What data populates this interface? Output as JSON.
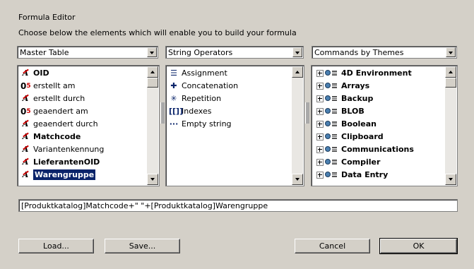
{
  "window": {
    "title": "Formula Editor",
    "subtitle": "Choose below the elements which will enable you to build your formula"
  },
  "dropdowns": {
    "table": "Master Table",
    "operators": "String Operators",
    "commands": "Commands by Themes"
  },
  "fields_list": [
    {
      "label": "OID",
      "icon": "alpha-field-icon",
      "bold": true
    },
    {
      "label": "erstellt am",
      "icon": "numeric-field-icon",
      "bold": false
    },
    {
      "label": "erstellt durch",
      "icon": "alpha-field-icon",
      "bold": false
    },
    {
      "label": "geaendert am",
      "icon": "numeric-field-icon",
      "bold": false
    },
    {
      "label": "geaendert durch",
      "icon": "alpha-field-icon",
      "bold": false
    },
    {
      "label": "Matchcode",
      "icon": "alpha-field-icon",
      "bold": true
    },
    {
      "label": "Variantenkennung",
      "icon": "alpha-field-icon",
      "bold": false
    },
    {
      "label": "LieferantenOID",
      "icon": "alpha-field-icon",
      "bold": true
    },
    {
      "label": "Warengruppe",
      "icon": "alpha-field-icon",
      "bold": true,
      "selected": true
    }
  ],
  "operators_list": [
    {
      "label": "Assignment",
      "icon": "assignment-icon",
      "glyph": "☰"
    },
    {
      "label": "Concatenation",
      "icon": "plus-icon",
      "glyph": "✚"
    },
    {
      "label": "Repetition",
      "icon": "asterisk-icon",
      "glyph": "✳"
    },
    {
      "label": "Indexes",
      "icon": "brackets-icon",
      "glyph": "[[]]"
    },
    {
      "label": "Empty string",
      "icon": "empty-string-icon",
      "glyph": "···"
    }
  ],
  "commands_list": [
    {
      "label": "4D Environment"
    },
    {
      "label": "Arrays"
    },
    {
      "label": "Backup"
    },
    {
      "label": "BLOB"
    },
    {
      "label": "Boolean"
    },
    {
      "label": "Clipboard"
    },
    {
      "label": "Communications"
    },
    {
      "label": "Compiler"
    },
    {
      "label": "Data Entry"
    }
  ],
  "formula": {
    "value": "[Produktkatalog]Matchcode+\" \"+[Produktkatalog]Warengruppe"
  },
  "buttons": {
    "load": "Load...",
    "save": "Save...",
    "cancel": "Cancel",
    "ok": "OK"
  },
  "colors": {
    "background": "#d4d0c8",
    "selection": "#0a246a"
  }
}
